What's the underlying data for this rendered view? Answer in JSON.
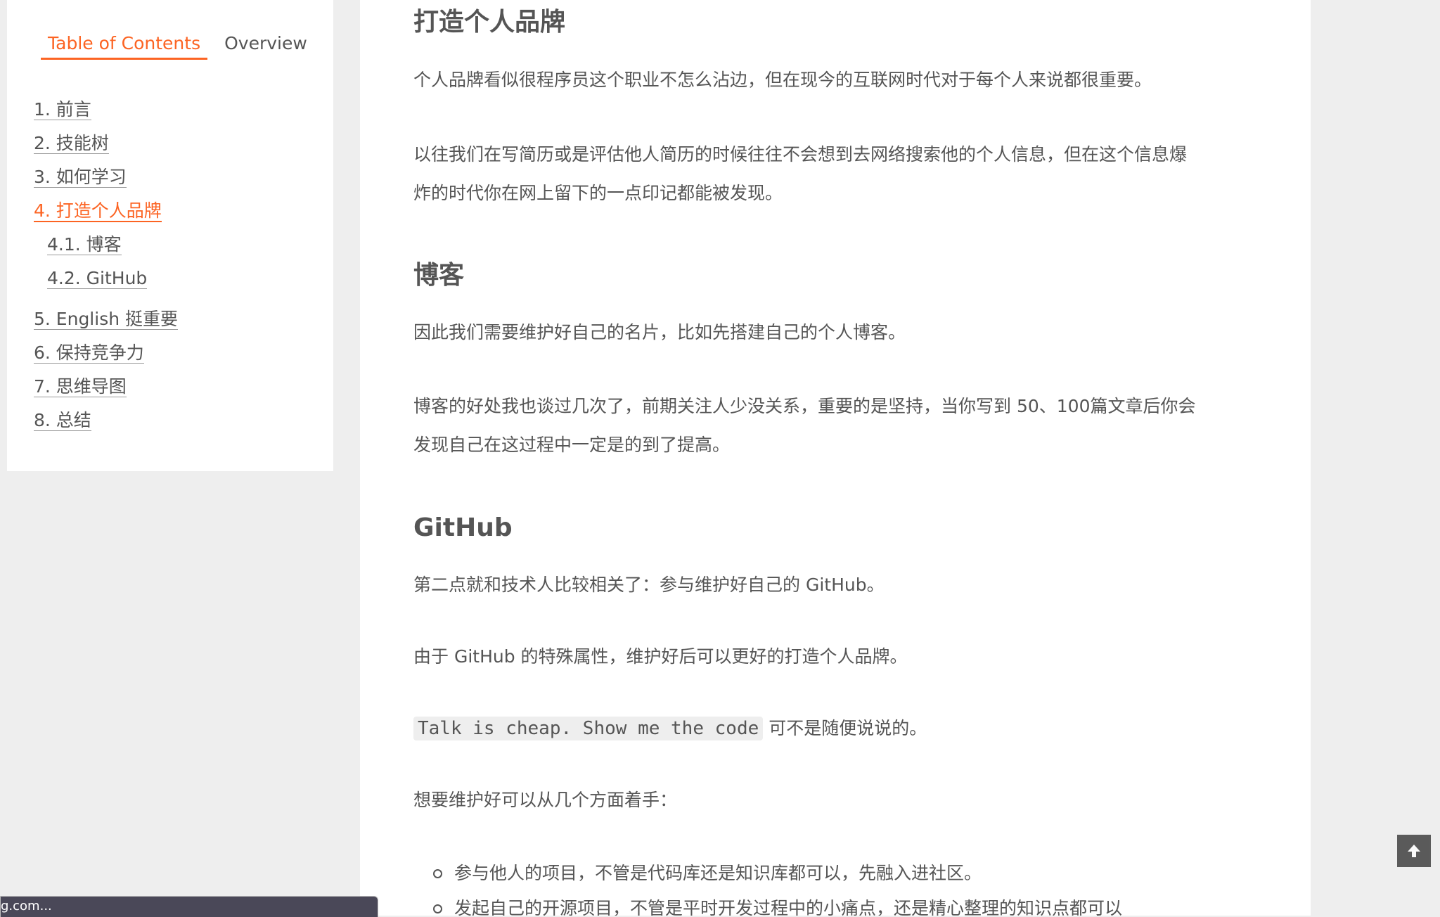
{
  "sidebar": {
    "tabs": [
      {
        "label": "Table of Contents",
        "active": true
      },
      {
        "label": "Overview",
        "active": false
      }
    ],
    "toc": [
      {
        "label": "1. 前言"
      },
      {
        "label": "2. 技能树"
      },
      {
        "label": "3. 如何学习"
      },
      {
        "label": "4. 打造个人品牌",
        "active": true
      },
      {
        "label": "4.1. 博客"
      },
      {
        "label": "4.2. GitHub"
      },
      {
        "label": "5. English 挺重要"
      },
      {
        "label": "6. 保持竞争力"
      },
      {
        "label": "7. 思维导图"
      },
      {
        "label": "8. 总结"
      }
    ]
  },
  "article": {
    "heading_brand": "打造个人品牌",
    "para_brand_1": "个人品牌看似很程序员这个职业不怎么沾边，但在现今的互联网时代对于每个人来说都很重要。",
    "para_brand_2_line1": "以往我们在写简历或是评估他人简历的时候往往不会想到去网络搜索他的个人信息，但在这个信息爆",
    "para_brand_2_line2": "炸的时代你在网上留下的一点印记都能被发现。",
    "heading_blog": "博客",
    "para_blog_1": "因此我们需要维护好自己的名片，比如先搭建自己的个人博客。",
    "para_blog_2_line1": "博客的好处我也谈过几次了，前期关注人少没关系，重要的是坚持，当你写到 50、100篇文章后你会",
    "para_blog_2_line2": "发现自己在这过程中一定是的到了提高。",
    "heading_github": "GitHub",
    "para_gh_1": "第二点就和技术人比较相关了：参与维护好自己的 GitHub。",
    "para_gh_2": "由于 GitHub 的特殊属性，维护好后可以更好的打造个人品牌。",
    "code_inline": "Talk is cheap. Show me the code",
    "para_gh_3_rest": " 可不是随便说说的。",
    "para_gh_4": "想要维护好可以从几个方面着手：",
    "bullets": [
      "参与他人的项目，不管是代码库还是知识库都可以，先融入进社区。",
      "发起自己的开源项目，不管是平时开发过程中的小痛点，还是精心整理的知识点都可以"
    ]
  },
  "status_bar": {
    "text": "g.com..."
  },
  "colors": {
    "accent": "#fc6423",
    "text": "#555555",
    "page_bg": "#eeeeee",
    "panel_bg": "#ffffff"
  },
  "icons": {
    "back_to_top": "arrow-up-icon"
  }
}
